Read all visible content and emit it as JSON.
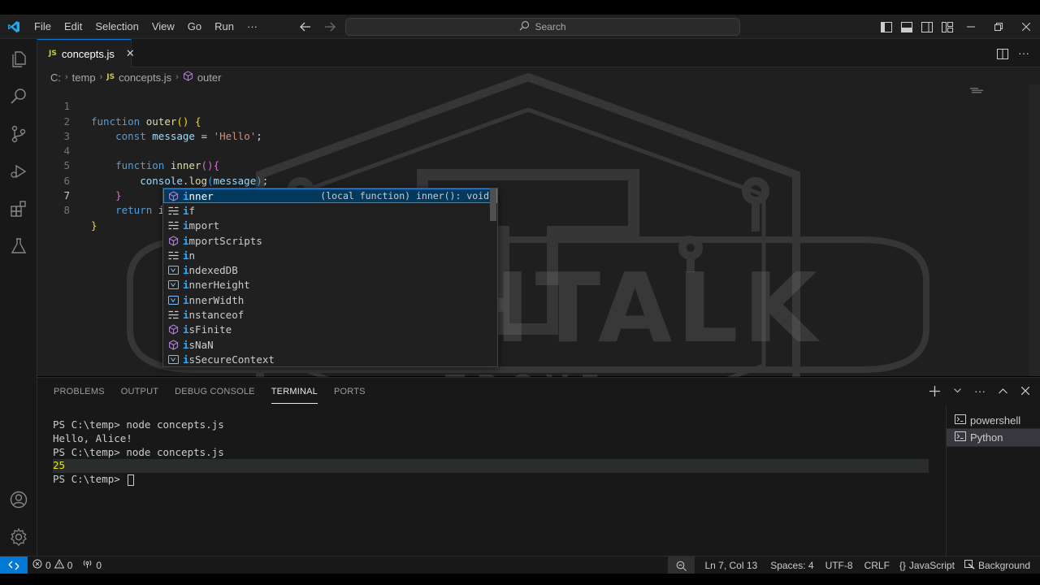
{
  "menu": [
    "File",
    "Edit",
    "Selection",
    "View",
    "Go",
    "Run",
    "···"
  ],
  "search": {
    "label": "Search"
  },
  "tab": {
    "badge": "JS",
    "label": "concepts.js",
    "close": "✕"
  },
  "breadcrumb": {
    "drive": "C:",
    "folder": "temp",
    "badge": "JS",
    "file": "concepts.js",
    "symbol": "outer"
  },
  "code_lines": [
    {
      "num": "1"
    },
    {
      "num": "2"
    },
    {
      "num": "3"
    },
    {
      "num": "4"
    },
    {
      "num": "5"
    },
    {
      "num": "6"
    },
    {
      "num": "7"
    },
    {
      "num": "8"
    }
  ],
  "code": {
    "l1": {
      "kw": "function",
      "name": "outer",
      "paren": "()",
      "brace": "{"
    },
    "l2": {
      "kw": "const",
      "var": "message",
      "op": "=",
      "str": "'Hello'",
      "end": ";"
    },
    "l4": {
      "kw": "function",
      "name": "inner",
      "paren": "()",
      "brace": "{"
    },
    "l5": {
      "obj": "console",
      "dot": ".",
      "fn": "log",
      "open": "(",
      "arg": "message",
      "close": ")",
      "end": ";"
    },
    "l6": {
      "brace": "}"
    },
    "l7": {
      "kw": "return",
      "typed": "i"
    },
    "l8": {
      "brace": "}"
    }
  },
  "suggestions": [
    {
      "match": "i",
      "rest": "nner",
      "icon": "method-icon",
      "detail": "(local function) inner(): void"
    },
    {
      "match": "i",
      "rest": "f",
      "icon": "keyword-icon"
    },
    {
      "match": "i",
      "rest": "mport",
      "icon": "keyword-icon"
    },
    {
      "match": "i",
      "rest": "mportScripts",
      "icon": "method-icon"
    },
    {
      "match": "i",
      "rest": "n",
      "icon": "keyword-icon"
    },
    {
      "match": "i",
      "rest": "ndexedDB",
      "icon": "variable-icon"
    },
    {
      "match": "i",
      "rest": "nnerHeight",
      "icon": "variable-icon"
    },
    {
      "match": "i",
      "rest": "nnerWidth",
      "icon": "variable-icon"
    },
    {
      "match": "i",
      "rest": "nstanceof",
      "icon": "keyword-icon"
    },
    {
      "match": "i",
      "rest": "sFinite",
      "icon": "method-icon"
    },
    {
      "match": "i",
      "rest": "sNaN",
      "icon": "method-icon"
    },
    {
      "match": "i",
      "rest": "sSecureContext",
      "icon": "variable-icon"
    }
  ],
  "watermark": {
    "title": "TECHTALK",
    "subtitle": "TROVE"
  },
  "panel": {
    "tabs": [
      "PROBLEMS",
      "OUTPUT",
      "DEBUG CONSOLE",
      "TERMINAL",
      "PORTS"
    ],
    "active_tab": "TERMINAL"
  },
  "terminal": {
    "lines": [
      {
        "prompt": "PS C:\\temp> ",
        "cmd": "node concepts.js"
      },
      {
        "text": "Hello, Alice!"
      },
      {
        "prompt": "PS C:\\temp> ",
        "cmd": "node concepts.js"
      },
      {
        "num": "25"
      },
      {
        "prompt": "PS C:\\temp> "
      }
    ],
    "sessions": [
      "powershell",
      "Python"
    ]
  },
  "status": {
    "errors": "0",
    "warnings": "0",
    "ports": "0",
    "position": "Ln 7, Col 13",
    "spaces": "Spaces: 4",
    "encoding": "UTF-8",
    "eol": "CRLF",
    "language": "JavaScript",
    "background": "Background"
  },
  "colors": {
    "accent": "#0078d4",
    "selection": "#04395e",
    "match": "#2aaaff",
    "keyword": "#569cd6",
    "function": "#dcdcaa",
    "variable": "#9cdcfe",
    "string": "#ce9178"
  }
}
